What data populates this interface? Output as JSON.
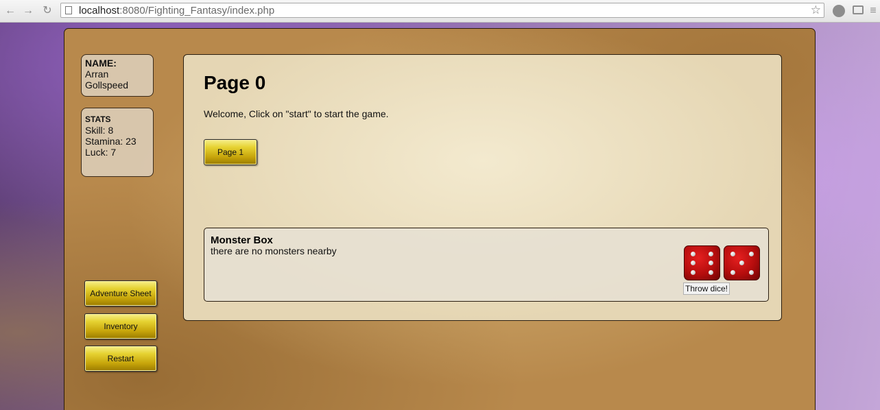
{
  "browser": {
    "url_host": "localhost",
    "url_rest": ":8080/Fighting_Fantasy/index.php"
  },
  "character": {
    "name_heading": "NAME:",
    "name_line1": "Arran",
    "name_line2": "Gollspeed"
  },
  "stats": {
    "heading": "STATS",
    "skill": "Skill: 8",
    "stamina": "Stamina: 23",
    "luck": "Luck: 7"
  },
  "sidebar_buttons": {
    "adventure_sheet": "Adventure Sheet",
    "inventory": "Inventory",
    "restart": "Restart"
  },
  "page": {
    "title": "Page 0",
    "text": "Welcome, Click on \"start\" to start the game.",
    "next_button": "Page 1"
  },
  "monster_box": {
    "title": "Monster Box",
    "text": "there are no monsters nearby",
    "dice_button": "Throw dice!",
    "dice_values": [
      6,
      5
    ]
  },
  "colors": {
    "parchment": "#b8894c",
    "gold_button": "#e6d232",
    "die_red": "#c81212"
  }
}
